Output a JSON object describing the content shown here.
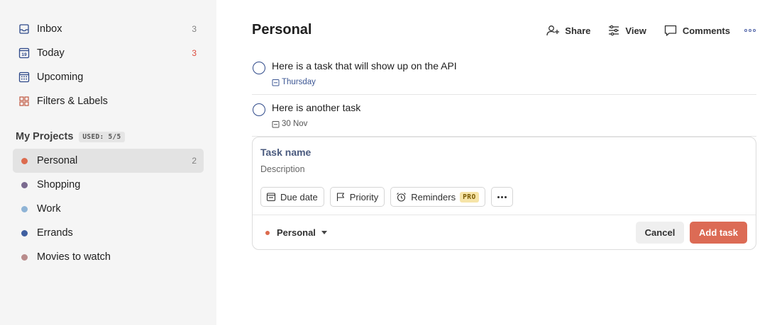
{
  "sidebar": {
    "nav": [
      {
        "label": "Inbox",
        "count": "3",
        "icon": "inbox-icon"
      },
      {
        "label": "Today",
        "count": "3",
        "icon": "calendar-today-icon"
      },
      {
        "label": "Upcoming",
        "count": "",
        "icon": "calendar-upcoming-icon"
      },
      {
        "label": "Filters & Labels",
        "count": "",
        "icon": "filters-labels-icon"
      }
    ],
    "projects_title": "My Projects",
    "projects_badge": "USED: 5/5",
    "projects": [
      {
        "label": "Personal",
        "count": "2",
        "color": "#dc6b4e",
        "active": true
      },
      {
        "label": "Shopping",
        "count": "",
        "color": "#7a6a8f"
      },
      {
        "label": "Work",
        "count": "",
        "color": "#8fb4d6"
      },
      {
        "label": "Errands",
        "count": "",
        "color": "#3f5fa0"
      },
      {
        "label": "Movies to watch",
        "count": "",
        "color": "#b98c8c"
      }
    ]
  },
  "main": {
    "title": "Personal",
    "toolbar": {
      "share": "Share",
      "view": "View",
      "comments": "Comments"
    },
    "tasks": [
      {
        "name": "Here is a task that will show up on the API",
        "due": "Thursday",
        "due_color": "#3d5794"
      },
      {
        "name": "Here is another task",
        "due": "30 Nov",
        "due_color": "#555555"
      }
    ],
    "editor": {
      "task_name_placeholder": "Task name",
      "description_placeholder": "Description",
      "due_date": "Due date",
      "priority": "Priority",
      "reminders": "Reminders",
      "pro_badge": "PRO",
      "project": "Personal",
      "cancel": "Cancel",
      "add_task": "Add task"
    }
  },
  "colors": {
    "accent": "#dc4c3e",
    "add_button": "#dc6b55",
    "sidebar_bg": "#f5f5f5"
  }
}
